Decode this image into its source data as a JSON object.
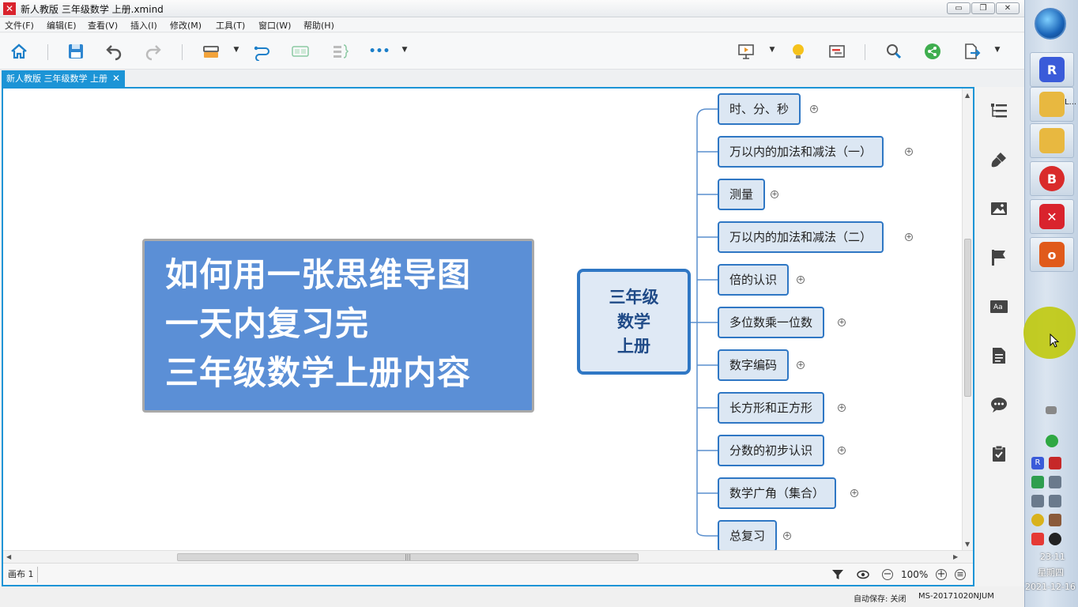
{
  "window": {
    "title": "新人教版 三年级数学 上册.xmind",
    "app_logo": "✕",
    "controls": {
      "minimize": "▭",
      "maximize": "❐",
      "close": "✕"
    }
  },
  "menu": [
    "文件(F)",
    "编辑(E)",
    "查看(V)",
    "插入(I)",
    "修改(M)",
    "工具(T)",
    "窗口(W)",
    "帮助(H)"
  ],
  "toolbar": {
    "icons": [
      "home-icon",
      "save-icon",
      "undo-icon",
      "redo-icon",
      "topic-style-icon",
      "relationship-icon",
      "boundary-icon",
      "summary-icon",
      "more-icon",
      "presentation-icon",
      "brainstorm-icon",
      "gantt-icon",
      "search-icon",
      "share-icon",
      "export-icon"
    ],
    "more_label": "•••"
  },
  "tab": {
    "label": "新人教版 三年级数学  上册",
    "close": "✕"
  },
  "canvas": {
    "title_card": {
      "lines": [
        "如何用一张思维导图",
        "一天内复习完",
        "三年级数学上册内容"
      ]
    },
    "central_topic": {
      "lines": [
        "三年级",
        "数学",
        "上册"
      ]
    },
    "subtopics": [
      "时、分、秒",
      "万以内的加法和减法（一）",
      "测量",
      "万以内的加法和减法（二）",
      "倍的认识",
      "多位数乘一位数",
      "数字编码",
      "长方形和正方形",
      "分数的初步认识",
      "数学广角（集合）",
      "总复习"
    ],
    "expander_symbol": "+"
  },
  "status": {
    "sheet": "画布 1",
    "zoom": "100%",
    "zoom_out": "−",
    "zoom_in": "+",
    "autosave": "自动保存: 关闭",
    "machine": "MS-20171020NJUM"
  },
  "side_panel_icons": [
    "outline-icon",
    "format-brush-icon",
    "image-icon",
    "marker-flag-icon",
    "font-icon",
    "notes-icon",
    "comments-icon",
    "task-icon"
  ],
  "taskbar": {
    "apps": [
      {
        "name": "app-r",
        "glyph": "R",
        "color": "#3a5bd9"
      },
      {
        "name": "folder-1",
        "glyph": "",
        "color": "#e8b840"
      },
      {
        "name": "folder-2",
        "glyph": "",
        "color": "#e8b840"
      },
      {
        "name": "app-b",
        "glyph": "B",
        "color": "#d92b2b"
      },
      {
        "name": "xmind",
        "glyph": "✕",
        "color": "#d9232d"
      },
      {
        "name": "app-office",
        "glyph": "o",
        "color": "#e05a1b"
      }
    ],
    "folder_label": "L...",
    "clock_time": "23:11",
    "clock_day": "星期四",
    "clock_date": "2021-12-16"
  },
  "colors": {
    "accent": "#1c94d6",
    "title_card_bg": "#5b8fd6",
    "central_border": "#2f77c4",
    "subtopic_bg": "#dce7f3"
  }
}
